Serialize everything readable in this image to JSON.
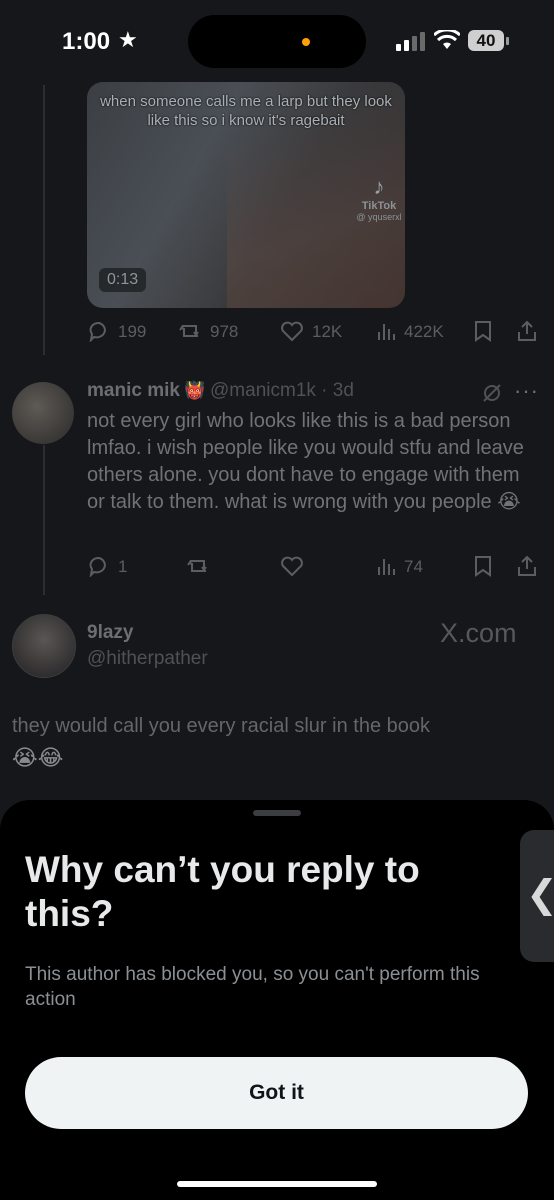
{
  "status_bar": {
    "time": "1:00",
    "battery": "40"
  },
  "video_post": {
    "caption": "when someone calls me a larp but they look like this so i know it's ragebait",
    "watermark_brand": "TikTok",
    "watermark_user": "@ yquserxl",
    "duration": "0:13",
    "stats": {
      "replies": "199",
      "reposts": "978",
      "likes": "12K",
      "views": "422K"
    }
  },
  "reply_tweet": {
    "name": "manic mik",
    "handle": "@manicm1k",
    "time": "3d",
    "text": "not every girl who looks like this is a bad person lmfao. i wish people like you would stfu and leave others alone. you dont have to engage with them or talk to them. what is wrong with you people 😭",
    "stats": {
      "replies": "1",
      "views": "74"
    }
  },
  "quoted_tweet": {
    "name": "9lazy",
    "handle": "@hitherpather",
    "source": "X.com",
    "text": "they would call you every racial slur in the book",
    "emoji": "😭😂"
  },
  "sheet": {
    "title": "Why can’t you reply to this?",
    "body": "This author has blocked you, so you can't perform this action",
    "button": "Got it"
  }
}
